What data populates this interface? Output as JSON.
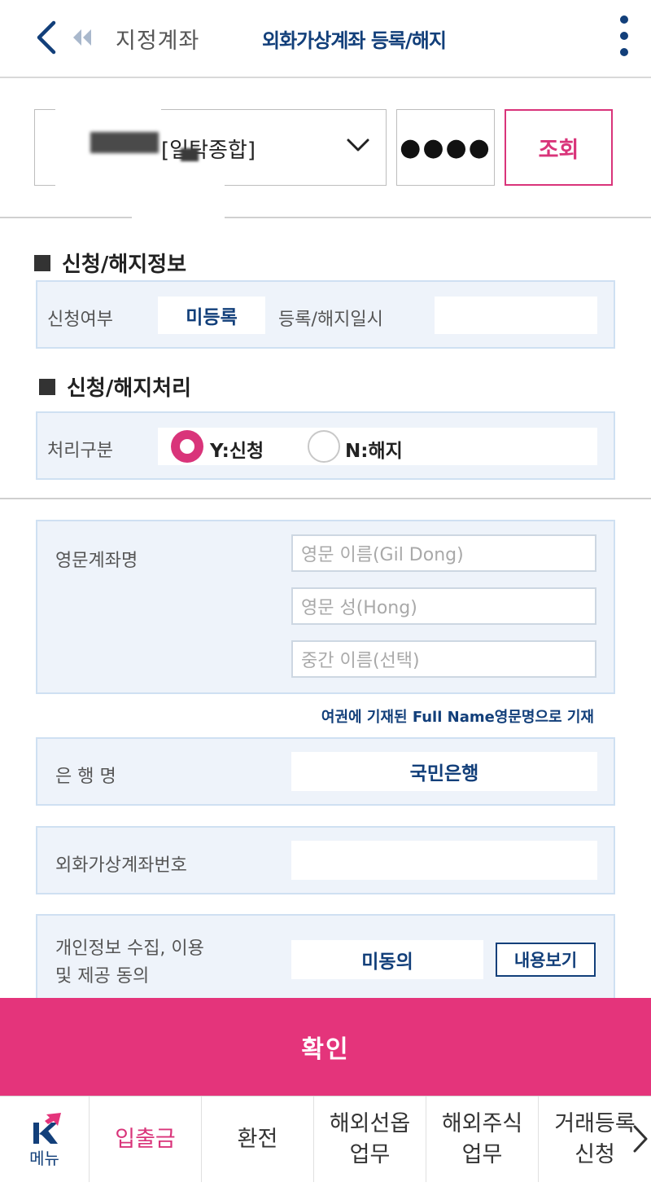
{
  "header": {
    "back_icon": "chevron-left-icon",
    "subtitle": "지정계좌",
    "title": "외화가상계좌 등록/해지",
    "more_icon": "kebab-menu-icon"
  },
  "account": {
    "label": "[일탁종합]",
    "password_mask": "●●●●",
    "query_label": "조회"
  },
  "sections": {
    "info_title": "신청/해지정보",
    "process_title": "신청/해지처리"
  },
  "info": {
    "apply_label": "신청여부",
    "apply_value": "미등록",
    "datetime_label": "등록/해지일시",
    "datetime_value": ""
  },
  "process": {
    "label": "처리구분",
    "option_yes": "Y:신청",
    "option_no": "N:해지",
    "selected": "Y"
  },
  "english_name": {
    "label": "영문계좌명",
    "first_placeholder": "영문 이름(Gil Dong)",
    "last_placeholder": "영문 성(Hong)",
    "middle_placeholder": "중간 이름(선택)",
    "note": "여권에 기재된 Full Name영문명으로 기재"
  },
  "bank": {
    "label": "은 행 명",
    "value": "국민은행"
  },
  "virtual_account": {
    "label": "외화가상계좌번호",
    "value": ""
  },
  "consent": {
    "label_line1": "개인정보 수집, 이용",
    "label_line2": "및 제공 동의",
    "value": "미동의",
    "view_label": "내용보기"
  },
  "confirm_label": "확인",
  "bottom_nav": {
    "menu_label": "메뉴",
    "items": [
      {
        "label": "입출금",
        "active": true
      },
      {
        "label": "환전",
        "active": false
      },
      {
        "line1": "해외선옵",
        "line2": "업무",
        "active": false
      },
      {
        "line1": "해외주식",
        "line2": "업무",
        "active": false
      },
      {
        "line1": "거래등록",
        "line2": "신청",
        "active": false
      }
    ]
  },
  "colors": {
    "accent": "#e4347b",
    "navy": "#123f7a",
    "panel_bg": "#eef3fa"
  }
}
